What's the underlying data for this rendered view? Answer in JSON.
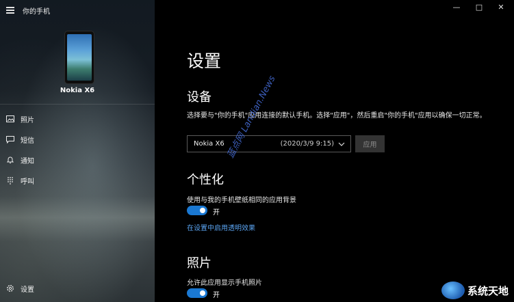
{
  "app": {
    "title": "你的手机"
  },
  "phone": {
    "name": "Nokia X6"
  },
  "nav": {
    "photos": "照片",
    "messages": "短信",
    "notifications": "通知",
    "calls": "呼叫",
    "settings": "设置"
  },
  "main": {
    "title": "设置",
    "devices": {
      "heading": "设备",
      "description": "选择要与\"你的手机\"应用连接的默认手机。选择\"应用\"，然后重启\"你的手机\"应用以确保一切正常。",
      "selected_phone": "Nokia X6",
      "selected_date": "(2020/3/9 9:15)",
      "apply_label": "应用"
    },
    "personalization": {
      "heading": "个性化",
      "wallpaper_label": "使用与我的手机壁纸相同的应用背景",
      "wallpaper_state": "开",
      "transparency_link": "在设置中启用透明效果"
    },
    "photos": {
      "heading": "照片",
      "allow_label": "允许此应用显示手机照片",
      "allow_state": "开"
    }
  },
  "watermarks": {
    "diagonal": "蓝点网 Landian.News",
    "corner": "系统天地"
  },
  "colors": {
    "accent": "#1a78d2",
    "link": "#5aa3f0",
    "background": "#000000"
  }
}
